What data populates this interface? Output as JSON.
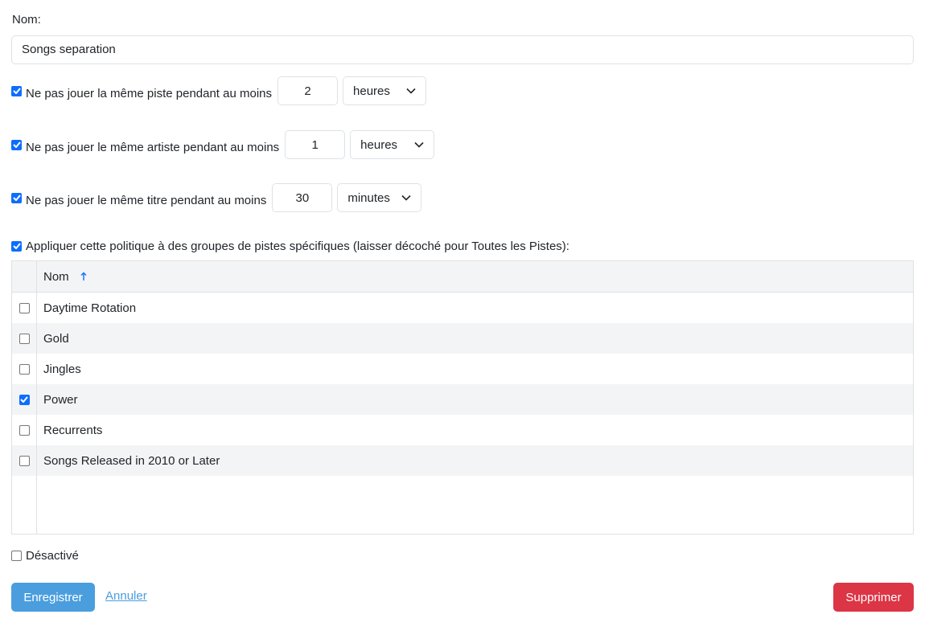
{
  "form": {
    "name_label": "Nom:",
    "name_value": "Songs separation"
  },
  "rules": [
    {
      "checked": true,
      "label": "Ne pas jouer la même piste pendant au moins",
      "value": "2",
      "unit": "heures"
    },
    {
      "checked": true,
      "label": "Ne pas jouer le même artiste pendant au moins",
      "value": "1",
      "unit": "heures"
    },
    {
      "checked": true,
      "label": "Ne pas jouer le même titre pendant au moins",
      "value": "30",
      "unit": "minutes"
    }
  ],
  "groups": {
    "checked": true,
    "label": "Appliquer cette politique à des groupes de pistes spécifiques (laisser décoché pour Toutes les Pistes):",
    "column_header": "Nom",
    "rows": [
      {
        "name": "Daytime Rotation",
        "checked": false
      },
      {
        "name": "Gold",
        "checked": false
      },
      {
        "name": "Jingles",
        "checked": false
      },
      {
        "name": "Power",
        "checked": true
      },
      {
        "name": "Recurrents",
        "checked": false
      },
      {
        "name": "Songs Released in 2010 or Later",
        "checked": false
      }
    ]
  },
  "disabled": {
    "checked": false,
    "label": "Désactivé"
  },
  "actions": {
    "save_label": "Enregistrer",
    "cancel_label": "Annuler",
    "delete_label": "Supprimer"
  },
  "colors": {
    "primary": "#4a9ede",
    "danger": "#dc3545",
    "checkbox": "#0d6efd"
  }
}
